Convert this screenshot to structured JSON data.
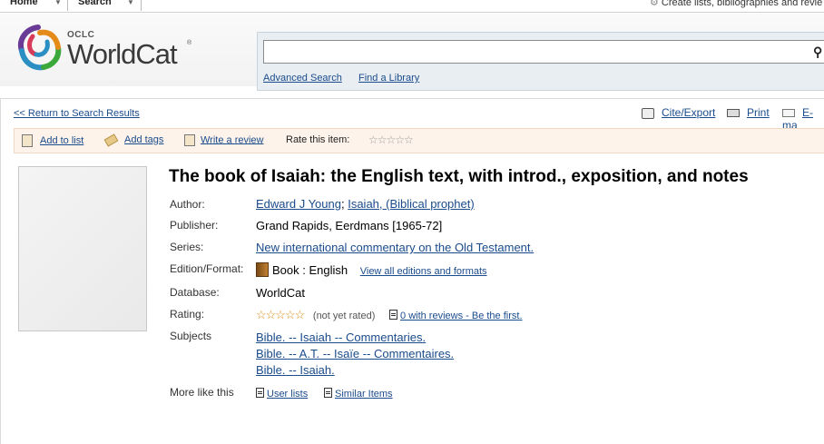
{
  "nav": {
    "home": "Home",
    "search": "Search",
    "create": "Create lists, bibliographies and revie"
  },
  "logo": {
    "oclc": "OCLC",
    "worldcat": "WorldCat",
    "reg": "®"
  },
  "search": {
    "value": "",
    "advanced": "Advanced Search",
    "find_library": "Find a Library"
  },
  "links": {
    "return": "<< Return to Search Results",
    "cite": "Cite/Export",
    "print": "Print",
    "email": "E-ma"
  },
  "toolbar": {
    "add_list": "Add to list",
    "add_tags": "Add tags",
    "write_review": "Write a review",
    "rate": "Rate this item:",
    "stars": "☆☆☆☆☆"
  },
  "record": {
    "title": "The book of Isaiah: the English text, with introd., exposition, and notes",
    "author_label": "Author:",
    "author1": "Edward J Young",
    "author_sep": ";",
    "author2": "Isaiah, (Biblical prophet)",
    "publisher_label": "Publisher:",
    "publisher": "Grand Rapids, Eerdmans [1965-72]",
    "series_label": "Series:",
    "series": "New international commentary on the Old Testament.",
    "edition_label": "Edition/Format:",
    "edition": "Book : English",
    "view_all": "View all editions and formats",
    "database_label": "Database:",
    "database": "WorldCat",
    "rating_label": "Rating:",
    "rating_stars": "☆☆☆☆☆",
    "not_rated": "(not yet rated)",
    "reviews": "0 with reviews - Be the first.",
    "subjects_label": "Subjects",
    "subjects": [
      "Bible. -- Isaiah -- Commentaries.",
      "Bible. -- A.T. -- Isaïe -- Commentaires.",
      "Bible. -- Isaiah."
    ],
    "more_label": "More like this",
    "user_lists": "User lists",
    "similar": "Similar Items"
  }
}
